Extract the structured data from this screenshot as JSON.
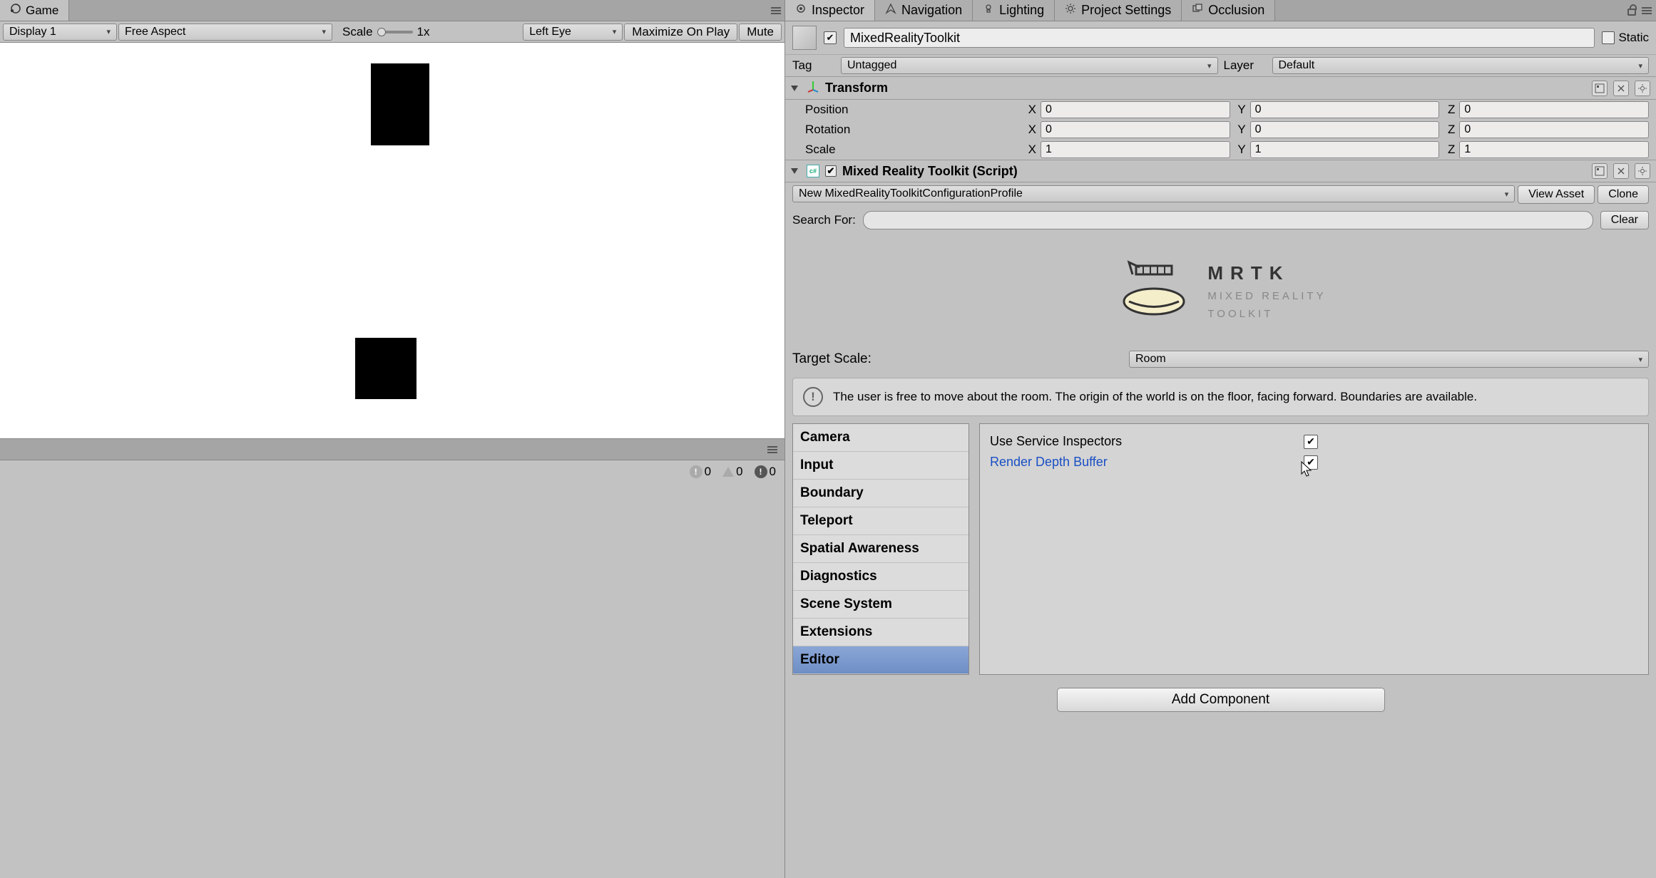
{
  "gameTab": {
    "label": "Game"
  },
  "gameToolbar": {
    "display": "Display 1",
    "aspect": "Free Aspect",
    "scaleLabel": "Scale",
    "scaleValue": "1x",
    "eye": "Left Eye",
    "maximize": "Maximize On Play",
    "mute": "Mute"
  },
  "console": {
    "info": "0",
    "warn": "0",
    "err": "0"
  },
  "inspectorTabs": {
    "inspector": "Inspector",
    "navigation": "Navigation",
    "lighting": "Lighting",
    "projectSettings": "Project Settings",
    "occlusion": "Occlusion"
  },
  "obj": {
    "name": "MixedRealityToolkit",
    "staticLabel": "Static",
    "tagLabel": "Tag",
    "tagValue": "Untagged",
    "layerLabel": "Layer",
    "layerValue": "Default"
  },
  "transform": {
    "title": "Transform",
    "position": "Position",
    "rotation": "Rotation",
    "scale": "Scale",
    "px": "0",
    "py": "0",
    "pz": "0",
    "rx": "0",
    "ry": "0",
    "rz": "0",
    "sx": "1",
    "sy": "1",
    "sz": "1"
  },
  "mrtk": {
    "title": "Mixed Reality Toolkit (Script)",
    "profile": "New MixedRealityToolkitConfigurationProfile",
    "viewAsset": "View Asset",
    "clone": "Clone",
    "searchLabel": "Search For:",
    "clear": "Clear",
    "logoTitle": "MRTK",
    "logoSub1": "MIXED REALITY",
    "logoSub2": "TOOLKIT",
    "targetLabel": "Target Scale:",
    "targetValue": "Room",
    "info": "The user is free to move about the room. The origin of the world is on the floor, facing forward. Boundaries are available.",
    "categories": [
      "Camera",
      "Input",
      "Boundary",
      "Teleport",
      "Spatial Awareness",
      "Diagnostics",
      "Scene System",
      "Extensions",
      "Editor"
    ],
    "selectedCategory": "Editor",
    "settings": {
      "useServiceInspectors": "Use Service Inspectors",
      "renderDepthBuffer": "Render Depth Buffer"
    },
    "addComponent": "Add Component"
  },
  "axes": {
    "x": "X",
    "y": "Y",
    "z": "Z"
  }
}
